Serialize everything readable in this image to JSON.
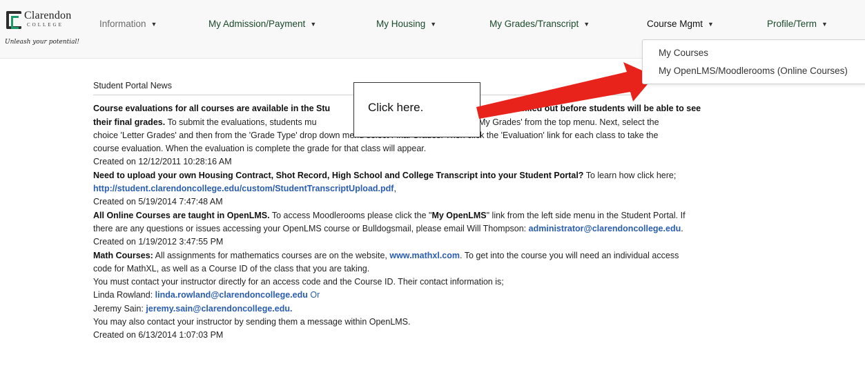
{
  "brand": {
    "name": "Clarendon",
    "sub": "COLLEGE",
    "tagline": "Unleash your potential!"
  },
  "nav": {
    "items": [
      {
        "label": "Information"
      },
      {
        "label": "My Admission/Payment"
      },
      {
        "label": "My Housing"
      },
      {
        "label": "My Grades/Transcript"
      },
      {
        "label": "Course Mgmt"
      },
      {
        "label": "Profile/Term"
      }
    ],
    "caret": "▼"
  },
  "dropdown": {
    "items": [
      {
        "label": "My Courses"
      },
      {
        "label": "My OpenLMS/Moodlerooms (Online Courses)"
      }
    ]
  },
  "callout": {
    "text": "Click  here."
  },
  "news": {
    "title": "Student Portal News",
    "p1_bold_a": "Course evaluations for all courses are available in the Stu",
    "p1_bold_b": "ach course must be filled out before students will be able to see",
    "p1_line2_bold": "their final grades.",
    "p1_line2": " To submit the evaluations, students mu",
    "p1_line2_b": "tal and select 'My Grades' from the top menu. Next, select the",
    "p1_line3": "choice 'Letter Grades' and then from the 'Grade Type' drop down menu select Final Grades. Then click the 'Evaluation' link for each class to take the",
    "p1_line4": "course evaluation. When the evaluation is complete the grade for that class will appear.",
    "p1_created": "Created on 12/12/2011 10:28:16 AM",
    "p2_bold": "Need to upload your own Housing Contract, Shot Record, High School and College Transcript into your Student Portal?",
    "p2_text": " To learn how click here;",
    "p2_link": "http://student.clarendoncollege.edu/custom/StudentTranscriptUpload.pdf",
    "p2_comma": ",",
    "p2_created": "Created on 5/19/2014 7:47:48 AM",
    "p3_bold": "All Online Courses are taught in OpenLMS.",
    "p3_text_a": " To access Moodlerooms please click the \"",
    "p3_bold2": "My OpenLMS",
    "p3_text_b": "\" link from the left side menu in the Student Portal. If",
    "p3_line2": "there are any questions or issues accessing your OpenLMS course or Bulldogsmail, please email Will Thompson: ",
    "p3_email": "administrator@clarendoncollege.edu",
    "p3_period": ".",
    "p3_created": "Created on 1/19/2012 3:47:55 PM",
    "p4_bold": "Math Courses:",
    "p4_text_a": " All assignments for mathematics courses are on the website, ",
    "p4_link": "www.mathxl.com",
    "p4_text_b": ".  To get into the course you will need an individual access",
    "p4_line2": "code for MathXL, as well as a Course ID of the class that you are taking.",
    "p4_line3": "You must contact your instructor directly for an access code and the Course ID. Their contact information is;",
    "p4_line4_name": "Linda Rowland: ",
    "p4_line4_email": "linda.rowland@clarendoncollege.edu",
    "p4_line4_or": " Or",
    "p4_line5_name": "Jeremy Sain: ",
    "p4_line5_email": "jeremy.sain@clarendoncollege.edu.",
    "p4_line6": "You may also contact your instructor by sending them a message within OpenLMS.",
    "p4_created": "Created on 6/13/2014 1:07:03 PM"
  },
  "colors": {
    "accent_link": "#2a5db0",
    "arrow": "#e8231c",
    "nav_green": "#1a4a2a"
  }
}
